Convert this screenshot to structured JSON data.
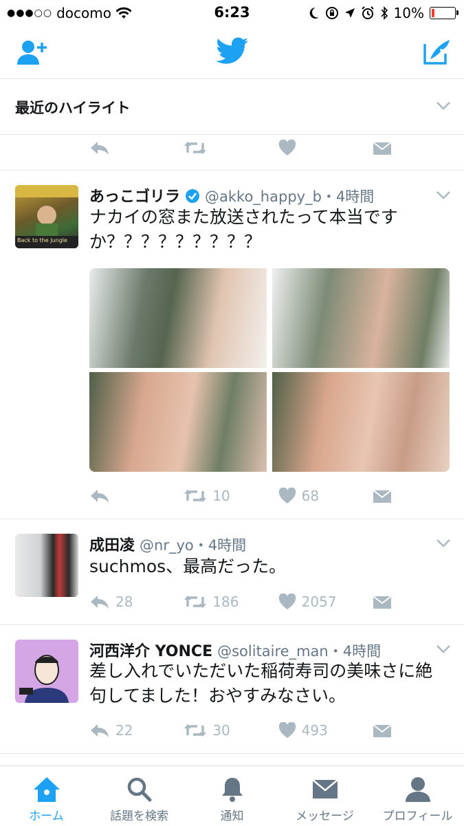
{
  "status": {
    "carrier": "docomo",
    "time": "6:23",
    "battery": "10%",
    "signal_dots": "●●●○○"
  },
  "highlights": {
    "title": "最近のハイライト"
  },
  "tweets": [
    {
      "name": "あっこゴリラ",
      "handle": "@akko_happy_b・4時間",
      "text": "ナカイの窓また放送されたって本当ですか？？？？？？？？？",
      "reply": "",
      "retweet": "10",
      "like": "68",
      "avatar_text": "Back to the Jungle"
    },
    {
      "name": "成田凌",
      "handle": "@nr_yo・4時間",
      "text": "suchmos、最高だった。",
      "reply": "28",
      "retweet": "186",
      "like": "2057"
    },
    {
      "name": "河西洋介 YONCE",
      "handle": "@solitaire_man・4時間",
      "text": "差し入れでいただいた稲荷寿司の美味さに絶句してました！おやすみなさい。",
      "reply": "22",
      "retweet": "30",
      "like": "493"
    }
  ],
  "tabs": [
    {
      "label": "ホーム"
    },
    {
      "label": "話題を検索"
    },
    {
      "label": "通知"
    },
    {
      "label": "メッセージ"
    },
    {
      "label": "プロフィール"
    }
  ],
  "colors": {
    "accent": "#1da1f2",
    "muted": "#aab8c2",
    "battery": "#ff3b30"
  }
}
